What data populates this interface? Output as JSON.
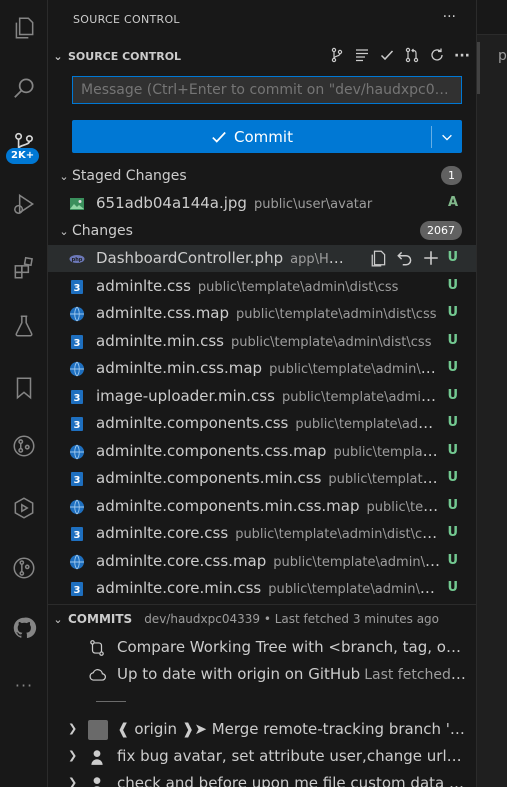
{
  "activity_bar": {
    "items": [
      "files-icon",
      "search-icon",
      "source-control-icon",
      "run-debug-icon",
      "extensions-icon",
      "testing-icon",
      "bookmarks-icon",
      "git-graph-icon",
      "remote-explorer-icon",
      "gitlens-icon",
      "github-icon"
    ],
    "badge": "2K+",
    "more": "···"
  },
  "view": {
    "title": "SOURCE CONTROL",
    "more": "···"
  },
  "scm": {
    "section_title": "SOURCE CONTROL",
    "message_placeholder": "Message (Ctrl+Enter to commit on \"dev/haudxpc04339\")",
    "commit_label": "Commit",
    "staged": {
      "label": "Staged Changes",
      "count": "1",
      "files": [
        {
          "name": "651adb04a144a.jpg",
          "path": "public\\user\\avatar",
          "status": "A",
          "icon": "image-icon"
        }
      ]
    },
    "changes": {
      "label": "Changes",
      "count": "2067",
      "files": [
        {
          "name": "DashboardController.php",
          "path": "app\\Http\\...",
          "status": "U",
          "icon": "php-icon"
        },
        {
          "name": "adminlte.css",
          "path": "public\\template\\admin\\dist\\css",
          "status": "U",
          "icon": "css-icon"
        },
        {
          "name": "adminlte.css.map",
          "path": "public\\template\\admin\\dist\\css",
          "status": "U",
          "icon": "css-map-icon"
        },
        {
          "name": "adminlte.min.css",
          "path": "public\\template\\admin\\dist\\css",
          "status": "U",
          "icon": "css-icon"
        },
        {
          "name": "adminlte.min.css.map",
          "path": "public\\template\\admin\\dis...",
          "status": "U",
          "icon": "css-map-icon"
        },
        {
          "name": "image-uploader.min.css",
          "path": "public\\template\\admin\\...",
          "status": "U",
          "icon": "css-icon"
        },
        {
          "name": "adminlte.components.css",
          "path": "public\\template\\admi...",
          "status": "U",
          "icon": "css-icon"
        },
        {
          "name": "adminlte.components.css.map",
          "path": "public\\template\\...",
          "status": "U",
          "icon": "css-map-icon"
        },
        {
          "name": "adminlte.components.min.css",
          "path": "public\\template\\a...",
          "status": "U",
          "icon": "css-icon"
        },
        {
          "name": "adminlte.components.min.css.map",
          "path": "public\\temp...",
          "status": "U",
          "icon": "css-map-icon"
        },
        {
          "name": "adminlte.core.css",
          "path": "public\\template\\admin\\dist\\css...",
          "status": "U",
          "icon": "css-icon"
        },
        {
          "name": "adminlte.core.css.map",
          "path": "public\\template\\admin\\di...",
          "status": "U",
          "icon": "css-map-icon"
        },
        {
          "name": "adminlte.core.min.css",
          "path": "public\\template\\admin\\dis...",
          "status": "U",
          "icon": "css-icon"
        }
      ]
    }
  },
  "commits": {
    "title": "COMMITS",
    "description": "dev/haudxpc04339 • Last fetched 3 minutes ago",
    "compare_text": "Compare Working Tree with <branch, tag, or ref>...",
    "uptodate_text": "Up to date with origin on GitHub",
    "uptodate_desc": "Last fetched 3 minutes ago",
    "entries": [
      {
        "text": "❰ origin ❱➤  Merge remote-tracking branch 'origin/..."
      },
      {
        "text": "fix bug avatar, set attribute user,change url me..."
      },
      {
        "text": "check and before upon me file custom data sh..."
      }
    ]
  },
  "editor": {
    "visible_char": "p"
  },
  "colors": {
    "accent": "#0078d4",
    "untracked": "#73c991",
    "added": "#81b88b"
  }
}
